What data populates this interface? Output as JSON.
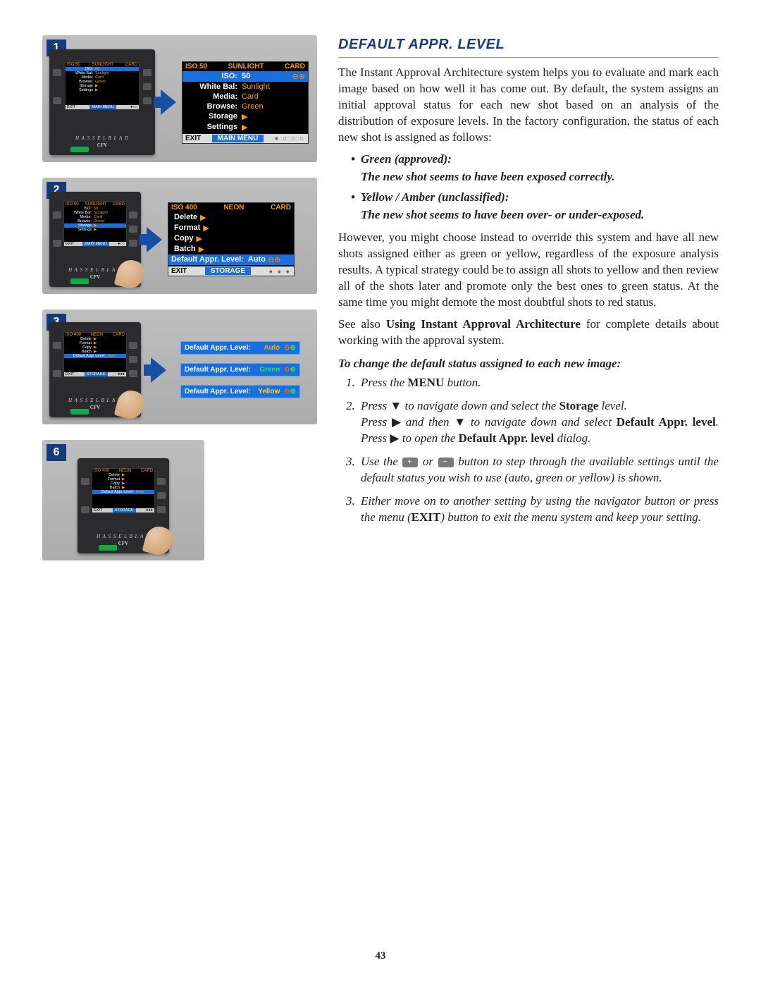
{
  "page_number": "43",
  "section_title": "DEFAULT APPR. LEVEL",
  "intro_para": "The Instant Approval Architecture system helps you to evaluate and mark each image based on how well it has come out. By default, the system assigns an initial approval status for each new shot based on an analysis of the distribution of exposure levels. In the factory configuration, the status of each new shot is assigned as follows:",
  "bullets": {
    "green_title": "Green (approved):",
    "green_desc": "The new shot seems to have been exposed correctly.",
    "yellow_title": "Yellow / Amber (unclassified):",
    "yellow_desc": "The new shot seems to have been over- or under-exposed."
  },
  "override_para": "However, you might choose instead to override this system and have all new shots assigned either as green or yellow, regardless of the exposure analysis results. A typical strategy could be to assign all shots to yellow and then review all of the shots later and promote only the best ones to green status. At the same time you might demote the most doubtful shots to red status.",
  "see_also_pre": "See also ",
  "see_also_bold": "Using Instant Approval Architecture",
  "see_also_post": " for complete details about working with the approval system.",
  "instr_title": "To change the default status assigned to each new image:",
  "steps": {
    "s1_pre": "Press the ",
    "s1_bold": "MENU",
    "s1_post": " button.",
    "s2_a": "Press ",
    "s2_b": " to navigate down and select the ",
    "s2_bold1": "Storage",
    "s2_c": " level.",
    "s2_d": "Press ",
    "s2_e": " and then ",
    "s2_f": " to navigate down and select ",
    "s2_bold2": "Default Appr. level",
    "s2_g": ". Press ",
    "s2_h": " to open the ",
    "s2_bold3": "Default Appr. level",
    "s2_i": " dialog.",
    "s3_a": "Use the ",
    "s3_b": " or ",
    "s3_c": " button to step through the available settings until the default status you wish to use (auto, green or yellow) is shown.",
    "s4_a": "Either move on to another setting by using the navigator button or press the menu (",
    "s4_bold": "EXIT",
    "s4_b": ") button to exit the menu system and keep your setting."
  },
  "panels": {
    "p1": {
      "num": "1",
      "top_l": "ISO 50",
      "top_c": "SUNLIGHT",
      "top_r": "CARD",
      "rows": [
        {
          "lab": "ISO:",
          "val": "50",
          "hl": true,
          "pm": true
        },
        {
          "lab": "White Bal:",
          "val": "Sunlight"
        },
        {
          "lab": "Media:",
          "val": "Card"
        },
        {
          "lab": "Browse:",
          "val": "Green"
        },
        {
          "lab": "Storage",
          "val": "▶"
        },
        {
          "lab": "Settings",
          "val": "▶"
        }
      ],
      "bot_l": "EXIT",
      "bot_c": "MAIN MENU",
      "bot_dots": "● ○ ○ ○"
    },
    "p2": {
      "num": "2",
      "top_l": "ISO 400",
      "top_c": "NEON",
      "top_r": "CARD",
      "rows": [
        {
          "lab": "Delete",
          "val": "▶"
        },
        {
          "lab": "Format",
          "val": "▶"
        },
        {
          "lab": "Copy",
          "val": "▶"
        },
        {
          "lab": "Batch",
          "val": "▶"
        },
        {
          "lab": "Default Appr. Level:",
          "val": "Auto",
          "hl": true,
          "pm": true,
          "wide": true
        }
      ],
      "bot_l": "EXIT",
      "bot_c": "STORAGE",
      "bot_dots": "● ● ●"
    },
    "p3": {
      "num": "3",
      "pills": [
        {
          "lab": "Default Appr. Level:",
          "val": "Auto",
          "cls": "auto"
        },
        {
          "lab": "Default Appr. Level:",
          "val": "Green",
          "cls": "green"
        },
        {
          "lab": "Default Appr. Level:",
          "val": "Yellow",
          "cls": "yellow"
        }
      ]
    },
    "p6": {
      "num": "6"
    }
  },
  "device": {
    "brand": "H A S S E L B L A D",
    "model": "CFV"
  }
}
